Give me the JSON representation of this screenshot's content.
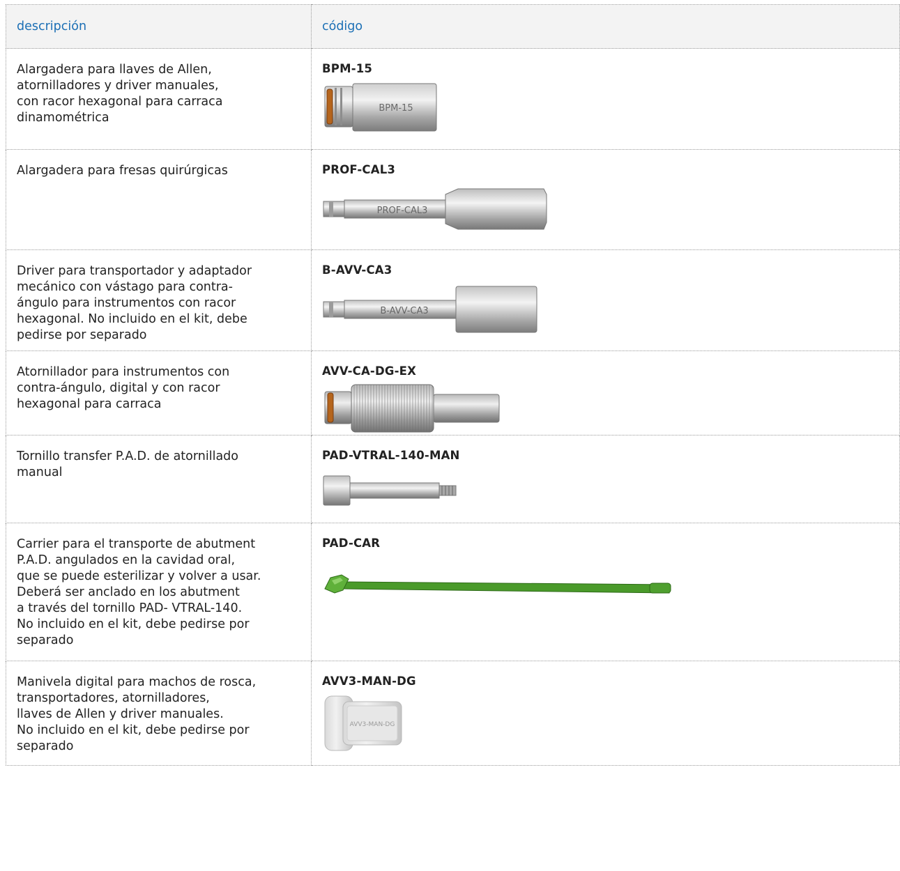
{
  "header": {
    "description": "descripción",
    "code": "código"
  },
  "rows": [
    {
      "description": "Alargadera para llaves de Allen,\natornilladores y driver manuales,\ncon racor hexagonal para carraca\ndinamométrica",
      "code": "BPM-15",
      "engraving": "BPM-15",
      "icon": "extension-tool-icon"
    },
    {
      "description": "Alargadera para fresas quirúrgicas",
      "code": "PROF-CAL3",
      "engraving": "PROF-CAL3",
      "icon": "drill-extension-icon"
    },
    {
      "description": "Driver para transportador y adaptador\nmecánico con vástago para contra-\nángulo para instrumentos con racor\nhexagonal. No incluido en el kit, debe\npedirse por separado",
      "code": "B-AVV-CA3",
      "engraving": "B-AVV-CA3",
      "icon": "driver-icon"
    },
    {
      "description": "Atornillador para instrumentos con\ncontra-ángulo, digital y con racor\nhexagonal para carraca",
      "code": "AVV-CA-DG-EX",
      "icon": "screwdriver-icon"
    },
    {
      "description": "Tornillo transfer P.A.D. de atornillado\nmanual",
      "code": "PAD-VTRAL-140-MAN",
      "icon": "transfer-screw-icon"
    },
    {
      "description": "Carrier para el transporte de abutment\nP.A.D. angulados en la cavidad oral,\nque se puede esterilizar y volver a usar.\nDeberá ser anclado en los abutment\na través del tornillo PAD- VTRAL-140.\nNo incluido en el kit, debe pedirse por\nseparado",
      "code": "PAD-CAR",
      "icon": "carrier-icon"
    },
    {
      "description": "Manivela digital para machos de rosca,\ntransportadores, atornilladores,\nllaves de Allen y driver manuales.\nNo incluido en el kit, debe pedirse por\nseparado",
      "code": "AVV3-MAN-DG",
      "engraving": "AVV3-MAN-DG",
      "icon": "handle-icon"
    }
  ],
  "colors": {
    "header_text": "#1b6fb5",
    "header_bg": "#f3f3f3",
    "oring": "#b5651d",
    "carrier": "#4a9a2a"
  }
}
